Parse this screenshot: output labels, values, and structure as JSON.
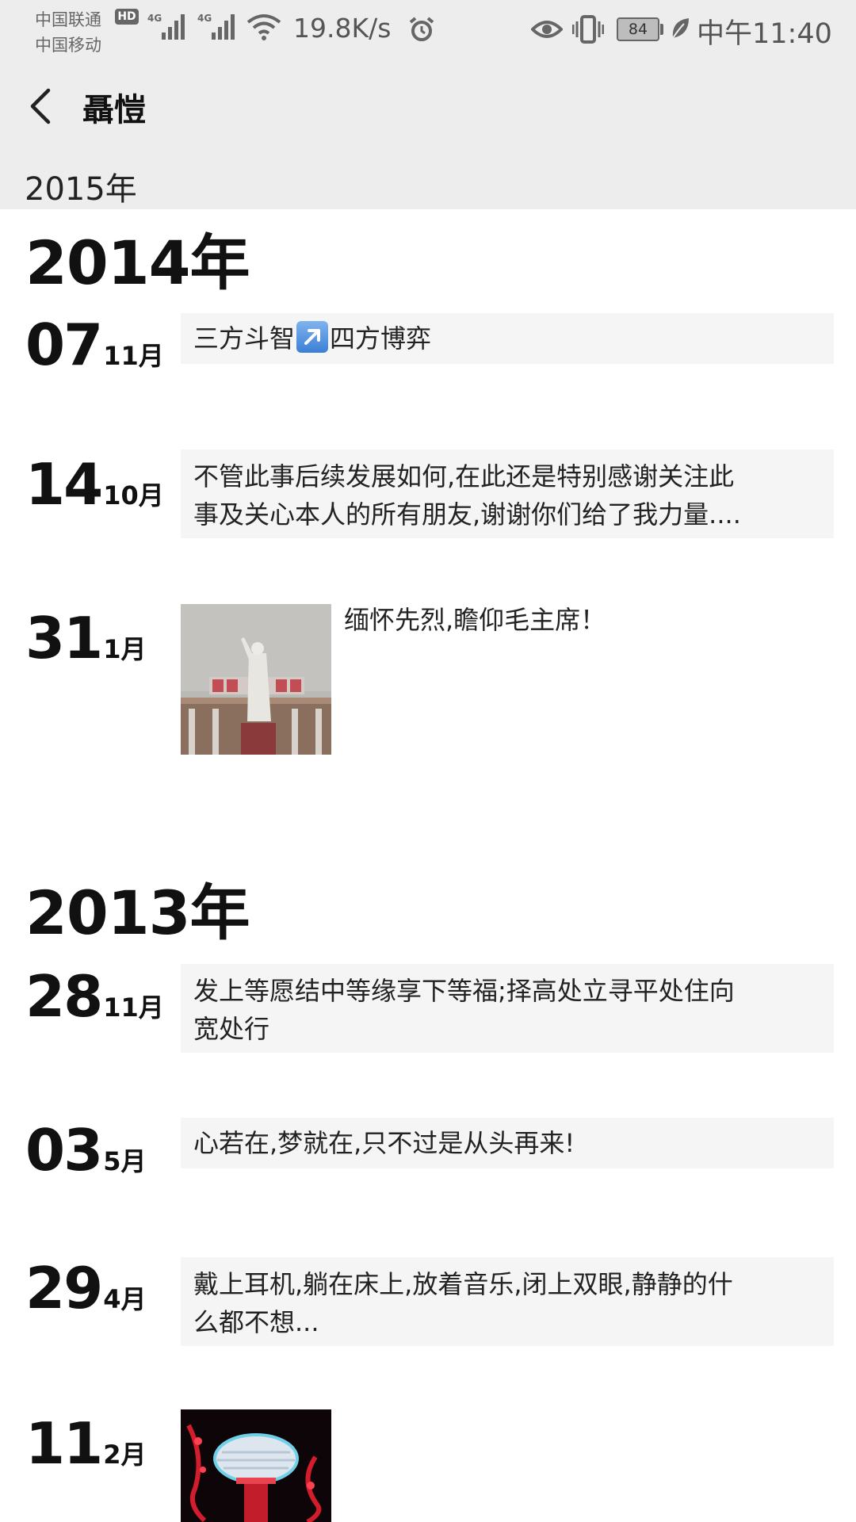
{
  "status_bar": {
    "carrier_1": "中国联通",
    "carrier_2": "中国移动",
    "hd_badge": "HD",
    "sim1_tag": "4G",
    "sim2_tag": "4G",
    "net_speed": "19.8K/s",
    "battery_level": "84",
    "time": "中午11:40"
  },
  "header": {
    "title": "聶愷",
    "sticky_year": "2015年"
  },
  "timeline": {
    "year_2014": "2014年",
    "year_2013": "2013年",
    "posts": [
      {
        "day": "07",
        "month": "11月",
        "text_a": "三方斗智",
        "emoji": "arrow-up-right",
        "text_b": "四方博弈"
      },
      {
        "day": "14",
        "month": "10月",
        "line1": "不管此事后续发展如何,在此还是特别感谢关注此",
        "line2": "事及关心本人的所有朋友,谢谢你们给了我力量...."
      },
      {
        "day": "31",
        "month": "1月",
        "caption": "缅怀先烈,瞻仰毛主席！"
      },
      {
        "day": "28",
        "month": "11月",
        "line1": "发上等愿结中等缘享下等福;择高处立寻平处住向",
        "line2": "宽处行"
      },
      {
        "day": "03",
        "month": "5月",
        "text": "心若在,梦就在,只不过是从头再来!"
      },
      {
        "day": "29",
        "month": "4月",
        "line1": "戴上耳机,躺在床上,放着音乐,闭上双眼,静静的什",
        "line2": "么都不想..."
      },
      {
        "day": "11",
        "month": "2月"
      }
    ]
  },
  "colors": {
    "header_bg": "#ededed",
    "card_bg": "#f5f5f5",
    "text": "#111111"
  }
}
